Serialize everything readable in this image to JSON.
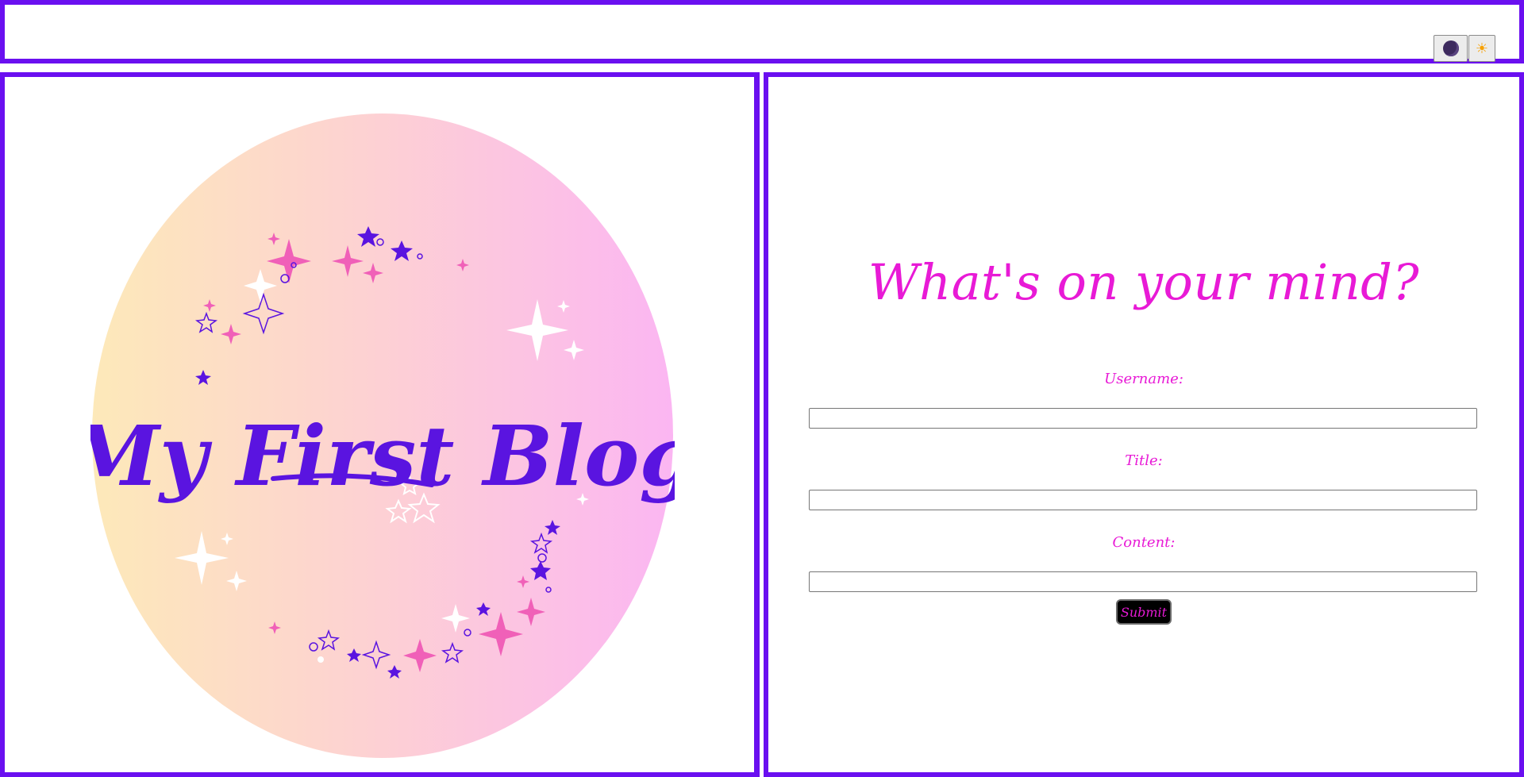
{
  "header": {
    "dark_mode_icon": "moon-icon",
    "light_mode_icon": "sun-icon"
  },
  "logo": {
    "text": "My First Blog",
    "colors": {
      "gradient_left": "#fde9b9",
      "gradient_mid": "#fdd0d4",
      "gradient_right": "#fbb6f2",
      "text": "#5a14e0",
      "accent_pink": "#f060b8"
    }
  },
  "form": {
    "title": "What's on your mind?",
    "fields": [
      {
        "label": "Username:",
        "value": "",
        "placeholder": ""
      },
      {
        "label": "Title:",
        "value": "",
        "placeholder": ""
      },
      {
        "label": "Content:",
        "value": "",
        "placeholder": ""
      }
    ],
    "submit_label": "Submit"
  },
  "colors": {
    "border": "#6a0ff0",
    "title": "#e81ad6",
    "button_bg": "#000000"
  }
}
